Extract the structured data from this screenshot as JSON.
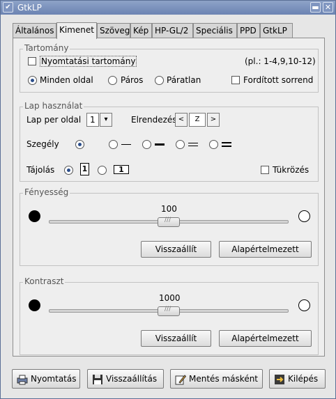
{
  "window": {
    "title": "GtkLP",
    "menu_glyph": "✔",
    "minimize_glyph": "▬",
    "close_glyph": "✕"
  },
  "tabs": [
    {
      "label": "Általános"
    },
    {
      "label": "Kimenet"
    },
    {
      "label": "Szöveg"
    },
    {
      "label": "Kép"
    },
    {
      "label": "HP-GL/2"
    },
    {
      "label": "Speciális"
    },
    {
      "label": "PPD"
    },
    {
      "label": "GtkLP"
    }
  ],
  "range": {
    "title": "Tartomány",
    "print_range_label": "Nyomtatási tartomány",
    "example": "(pl.: 1-4,9,10-12)",
    "all_pages": "Minden oldal",
    "even": "Páros",
    "odd": "Páratlan",
    "reverse": "Fordított sorrend"
  },
  "page_usage": {
    "title": "Lap használat",
    "per_sheet_label": "Lap per oldal",
    "per_sheet_value": "1",
    "layout_label": "Elrendezés",
    "layout_prev": "<",
    "layout_icon": "Z",
    "layout_next": ">",
    "border_label": "Szegély",
    "orientation_label": "Tájolás",
    "mirror_label": "Tükrözés",
    "portrait_glyph": "1",
    "landscape_glyph": "1"
  },
  "brightness": {
    "title": "Fényesség",
    "value": "100",
    "level": 0.5,
    "reset": "Visszaállít",
    "default": "Alapértelmezett"
  },
  "contrast": {
    "title": "Kontraszt",
    "value": "1000",
    "level": 0.5,
    "reset": "Visszaállít",
    "default": "Alapértelmezett"
  },
  "footer": {
    "print": "Nyomtatás",
    "restore": "Visszaállítás",
    "save_as": "Mentés másként",
    "quit": "Kilépés"
  }
}
